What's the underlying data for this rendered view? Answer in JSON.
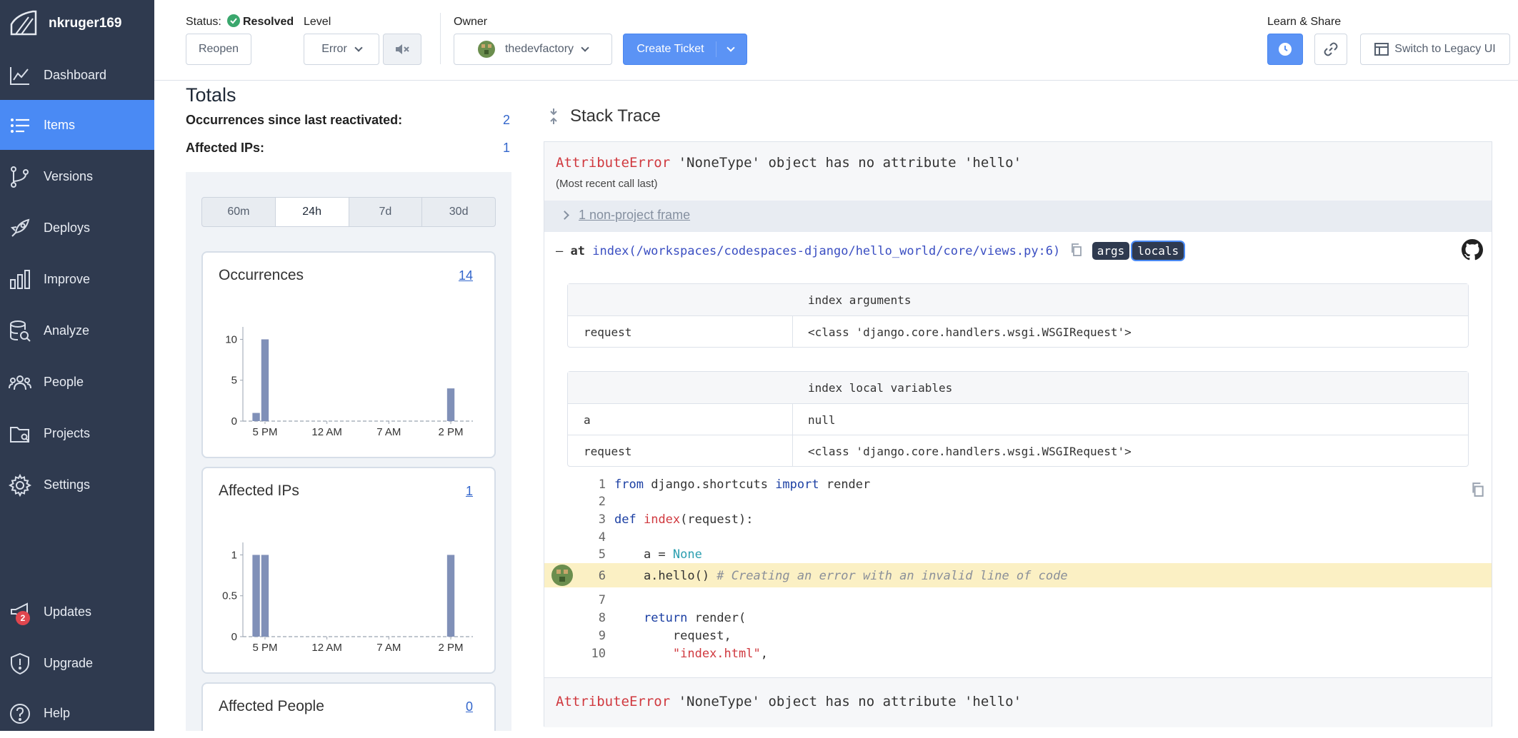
{
  "sidebar": {
    "username": "nkruger169",
    "items": [
      {
        "label": "Dashboard",
        "icon": "dashboard-chart-icon"
      },
      {
        "label": "Items",
        "icon": "list-icon",
        "active": true
      },
      {
        "label": "Versions",
        "icon": "branch-icon"
      },
      {
        "label": "Deploys",
        "icon": "rocket-icon"
      },
      {
        "label": "Improve",
        "icon": "bar-chart-icon"
      },
      {
        "label": "Analyze",
        "icon": "database-search-icon"
      },
      {
        "label": "People",
        "icon": "people-icon"
      },
      {
        "label": "Projects",
        "icon": "folder-icon"
      },
      {
        "label": "Settings",
        "icon": "gear-icon"
      }
    ],
    "bottom_items": [
      {
        "label": "Updates",
        "icon": "megaphone-icon",
        "badge": "2"
      },
      {
        "label": "Upgrade",
        "icon": "shield-icon"
      },
      {
        "label": "Help",
        "icon": "help-circle-icon"
      }
    ]
  },
  "topbar": {
    "status_label": "Status:",
    "status_value": "Resolved",
    "reopen_label": "Reopen",
    "level_label": "Level",
    "level_value": "Error",
    "owner_label": "Owner",
    "owner_value": "thedevfactory",
    "create_ticket_label": "Create Ticket",
    "learn_share_label": "Learn & Share",
    "legacy_label": "Switch to Legacy UI"
  },
  "totals": {
    "title": "Totals",
    "occurrences_label": "Occurrences since last reactivated:",
    "occurrences_value": "2",
    "ips_label": "Affected IPs:",
    "ips_value": "1",
    "ranges": [
      "60m",
      "24h",
      "7d",
      "30d"
    ],
    "active_range": "24h"
  },
  "cards": [
    {
      "title": "Occurrences",
      "link": "14"
    },
    {
      "title": "Affected IPs",
      "link": "1"
    },
    {
      "title": "Affected People",
      "link": "0"
    }
  ],
  "chart_data": [
    {
      "type": "bar",
      "title": "Occurrences",
      "x_ticks": [
        "5 PM",
        "12 AM",
        "7 AM",
        "2 PM"
      ],
      "y_ticks": [
        "0",
        "5",
        "10"
      ],
      "ylim": [
        0,
        11
      ],
      "values": [
        0,
        1,
        10,
        0,
        0,
        0,
        0,
        0,
        0,
        0,
        0,
        0,
        0,
        0,
        0,
        0,
        0,
        0,
        0,
        0,
        0,
        0,
        0,
        4,
        0,
        0
      ]
    },
    {
      "type": "bar",
      "title": "Affected IPs",
      "x_ticks": [
        "5 PM",
        "12 AM",
        "7 AM",
        "2 PM"
      ],
      "y_ticks": [
        "0",
        "0.5",
        "1"
      ],
      "ylim": [
        0,
        1.1
      ],
      "values": [
        0,
        1,
        1,
        0,
        0,
        0,
        0,
        0,
        0,
        0,
        0,
        0,
        0,
        0,
        0,
        0,
        0,
        0,
        0,
        0,
        0,
        0,
        0,
        1,
        0,
        0
      ]
    }
  ],
  "stack": {
    "title": "Stack Trace",
    "error_type": "AttributeError",
    "error_msg": "'NoneType' object has no attribute 'hello'",
    "recent_call": "(Most recent call last)",
    "non_project": "1 non-project frame",
    "frame_prefix": "–",
    "frame_at": "at",
    "frame_path": "index(/workspaces/codespaces-django/hello_world/core/views.py:6)",
    "pill_args": "args",
    "pill_locals": "locals",
    "args_header": "index arguments",
    "args": [
      {
        "k": "request",
        "v": "<class 'django.core.handlers.wsgi.WSGIRequest'>"
      }
    ],
    "locals_header": "index local variables",
    "locals": [
      {
        "k": "a",
        "v": "null"
      },
      {
        "k": "request",
        "v": "<class 'django.core.handlers.wsgi.WSGIRequest'>"
      }
    ],
    "code": {
      "l1a": "from",
      "l1b": " django.shortcuts ",
      "l1c": "import",
      "l1d": " render",
      "l3a": "def",
      "l3b": "index",
      "l3c": "(request):",
      "l5a": "    a = ",
      "l5b": "None",
      "l6a": "    a.hello() ",
      "l6b": "# Creating an error with an invalid line of code",
      "l8a": "    ",
      "l8b": "return",
      "l8c": " render(",
      "l9a": "        request,",
      "l10a": "        ",
      "l10b": "\"index.html\"",
      "l10c": ","
    },
    "line_numbers": [
      "1",
      "2",
      "3",
      "4",
      "5",
      "6",
      "7",
      "8",
      "9",
      "10"
    ]
  }
}
